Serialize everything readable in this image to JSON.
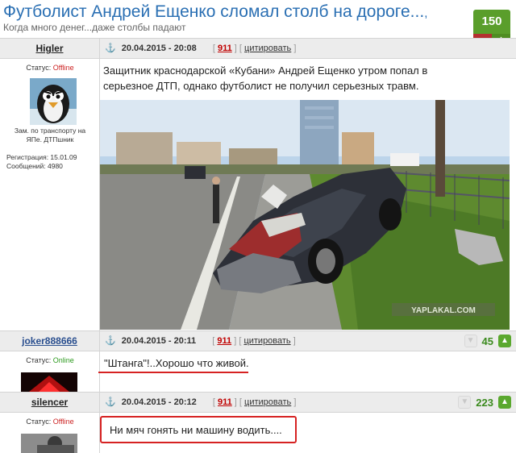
{
  "topic": {
    "title": "Футболист Андрей Ещенко сломал столб на дороге...",
    "title_suffix": ",",
    "subtitle": "Когда много денег...даже столбы падают",
    "rating": "150",
    "rating_minus": "–",
    "rating_plus": "+"
  },
  "posts": [
    {
      "author": "Higler",
      "status_label": "Статус:",
      "status": "Offline",
      "user_title_line1": "Зам. по транспорту на",
      "user_title_line2": "ЯПе. ДТПшник",
      "reg_label": "Регистрация: 15.01.09",
      "msgs_label": "Сообщений: 4980",
      "date": "20.04.2015 - 20:08",
      "num": "911",
      "quote": "цитировать",
      "text_line1": "Защитник краснодарской «Кубани» Андрей Ещенко утром попал в",
      "text_line2": "серьезное ДТП, однако футболист не получил серьезных травм.",
      "watermark": "YAPLAKAL.COM"
    },
    {
      "author": "joker888666",
      "status_label": "Статус:",
      "status": "Online",
      "date": "20.04.2015 - 20:11",
      "num": "911",
      "quote": "цитировать",
      "rating": "45",
      "text": "\"Штанга\"!..Хорошо что живой."
    },
    {
      "author": "silencer",
      "status_label": "Статус:",
      "status": "Offline",
      "date": "20.04.2015 - 20:12",
      "num": "911",
      "quote": "цитировать",
      "rating": "223",
      "text": "Ни мяч гонять ни машину водить...."
    }
  ],
  "colors": {
    "title_blue": "#2a6fb3",
    "rating_green": "#5a9e2b",
    "highlight_red": "#d62222",
    "offline_red": "#cc2222",
    "online_green": "#2e9a1f"
  }
}
